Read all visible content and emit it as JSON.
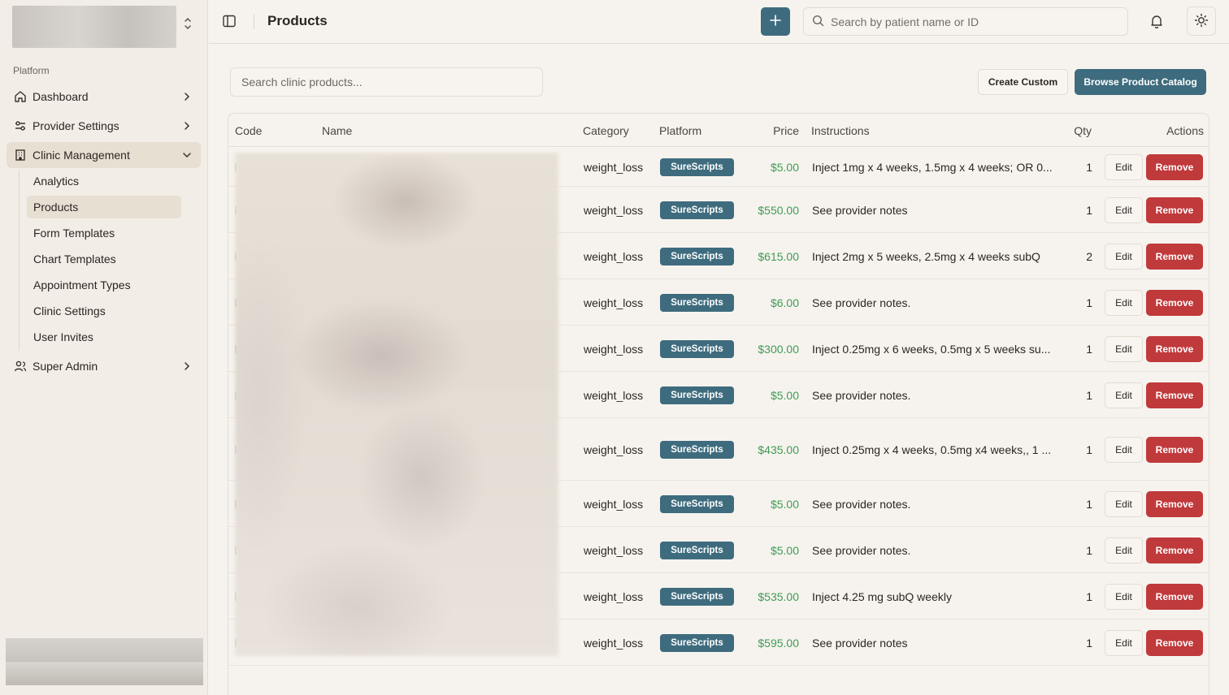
{
  "sidebar": {
    "section_label": "Platform",
    "nav": [
      {
        "label": "Dashboard",
        "icon": "home-icon"
      },
      {
        "label": "Provider Settings",
        "icon": "sliders-icon"
      },
      {
        "label": "Clinic Management",
        "icon": "building-icon"
      },
      {
        "label": "Super Admin",
        "icon": "users-icon"
      }
    ],
    "clinic_sub": [
      "Analytics",
      "Products",
      "Form Templates",
      "Chart Templates",
      "Appointment Types",
      "Clinic Settings",
      "User Invites"
    ]
  },
  "header": {
    "title": "Products",
    "search_placeholder": "Search by patient name or ID"
  },
  "toolbar": {
    "product_search_placeholder": "Search clinic products...",
    "create_label": "Create Custom",
    "browse_label": "Browse Product Catalog"
  },
  "table": {
    "headers": {
      "code": "Code",
      "name": "Name",
      "category": "Category",
      "platform": "Platform",
      "price": "Price",
      "instructions": "Instructions",
      "qty": "Qty",
      "actions": "Actions"
    },
    "edit_label": "Edit",
    "remove_label": "Remove",
    "rows": [
      {
        "category": "weight_loss",
        "platform": "SureScripts",
        "price": "$5.00",
        "instructions": "Inject 1mg x 4 weeks, 1.5mg x 4 weeks; OR 0...",
        "qty": "1"
      },
      {
        "category": "weight_loss",
        "platform": "SureScripts",
        "price": "$550.00",
        "instructions": "See provider notes",
        "qty": "1"
      },
      {
        "category": "weight_loss",
        "platform": "SureScripts",
        "price": "$615.00",
        "instructions": "Inject 2mg x 5 weeks, 2.5mg x 4 weeks subQ",
        "qty": "2"
      },
      {
        "category": "weight_loss",
        "platform": "SureScripts",
        "price": "$6.00",
        "instructions": "See provider notes.",
        "qty": "1"
      },
      {
        "category": "weight_loss",
        "platform": "SureScripts",
        "price": "$300.00",
        "instructions": "Inject 0.25mg x 6 weeks, 0.5mg x 5 weeks su...",
        "qty": "1"
      },
      {
        "category": "weight_loss",
        "platform": "SureScripts",
        "price": "$5.00",
        "instructions": "See provider notes.",
        "qty": "1"
      },
      {
        "category": "weight_loss",
        "platform": "SureScripts",
        "price": "$435.00",
        "instructions": "Inject 0.25mg x 4 weeks, 0.5mg x4 weeks,, 1 ...",
        "qty": "1"
      },
      {
        "category": "weight_loss",
        "platform": "SureScripts",
        "price": "$5.00",
        "instructions": "See provider notes.",
        "qty": "1"
      },
      {
        "category": "weight_loss",
        "platform": "SureScripts",
        "price": "$5.00",
        "instructions": "See provider notes.",
        "qty": "1"
      },
      {
        "category": "weight_loss",
        "platform": "SureScripts",
        "price": "$535.00",
        "instructions": "Inject 4.25 mg subQ weekly",
        "qty": "1"
      },
      {
        "category": "weight_loss",
        "platform": "SureScripts",
        "price": "$595.00",
        "instructions": "See provider notes",
        "qty": "1"
      }
    ]
  },
  "colors": {
    "accent": "#3e6c7e",
    "danger": "#c0393b",
    "price": "#3f9b55"
  }
}
